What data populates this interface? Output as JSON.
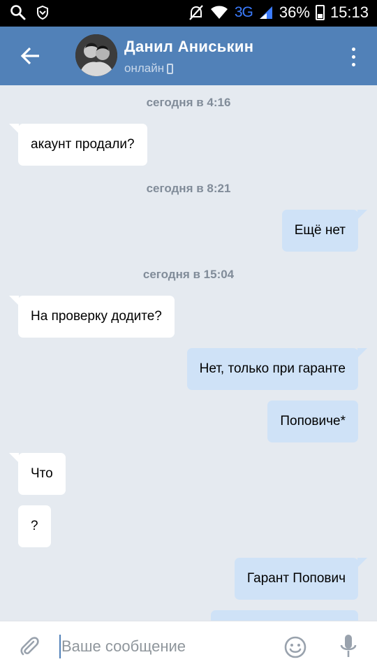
{
  "status_bar": {
    "network": "3G",
    "battery": "36%",
    "time": "15:13",
    "icons": [
      "search-icon",
      "shield-icon",
      "mute-icon",
      "wifi-icon",
      "signal-icon",
      "battery-icon"
    ]
  },
  "header": {
    "name": "Данил Аниськин",
    "status": "онлайн",
    "color": "#5181b8",
    "icons": [
      "back-arrow-icon",
      "avatar",
      "mobile-phone-icon",
      "more-vertical-icon"
    ]
  },
  "chat": {
    "dates": [
      "сегодня в 4:16",
      "сегодня в 8:21",
      "сегодня в 15:04"
    ],
    "messages": [
      {
        "direction": "in",
        "text": "акаунт продали?"
      },
      {
        "direction": "out",
        "text": "Ещё нет"
      },
      {
        "direction": "in",
        "text": "На проверку додите?"
      },
      {
        "direction": "out",
        "text": "Нет, только при гаранте"
      },
      {
        "direction": "out",
        "text": "Поповиче*"
      },
      {
        "direction": "in",
        "text": "Что"
      },
      {
        "direction": "in",
        "text": "?"
      },
      {
        "direction": "out",
        "text": "Гарант Попович"
      }
    ],
    "colors": {
      "incoming": "#ffffff",
      "outgoing": "#cfe2f7",
      "background": "#e5eaf0"
    }
  },
  "composer": {
    "placeholder": "Ваше сообщение",
    "value": "",
    "icons": [
      "attach-icon",
      "emoji-icon",
      "microphone-icon"
    ]
  }
}
